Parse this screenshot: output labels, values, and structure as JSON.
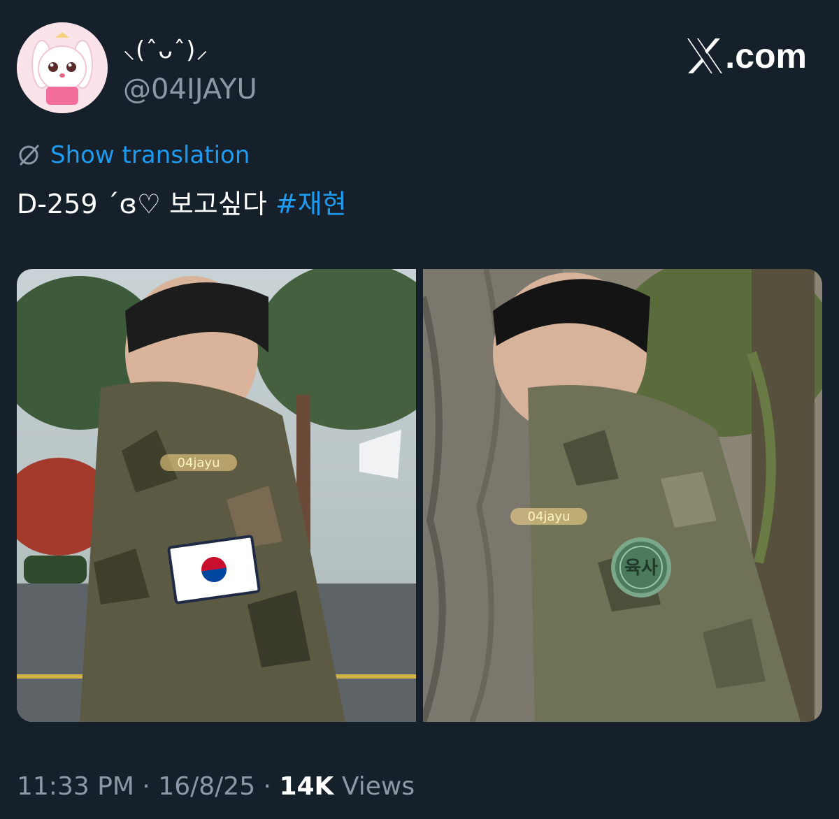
{
  "author": {
    "display_name": "⸜(ˆᴗˆ)⸝",
    "handle": "@04IJAYU"
  },
  "brand": {
    "label": ".com"
  },
  "translation": {
    "label": "Show translation"
  },
  "tweet": {
    "text": "D-259 ´ɞ♡ 보고싶다 ",
    "hashtag": "#재현"
  },
  "media": {
    "photos": [
      {
        "watermark": "04jayu",
        "patch": "flag"
      },
      {
        "watermark": "04jayu",
        "patch_text": "육사"
      }
    ]
  },
  "meta": {
    "time": "11:33 PM",
    "separator": " · ",
    "date": "16/8/25",
    "views_count": "14K",
    "views_label": "Views"
  },
  "colors": {
    "background": "#15202b",
    "accent": "#1d9bf0",
    "secondary_text": "#8b98a5"
  }
}
